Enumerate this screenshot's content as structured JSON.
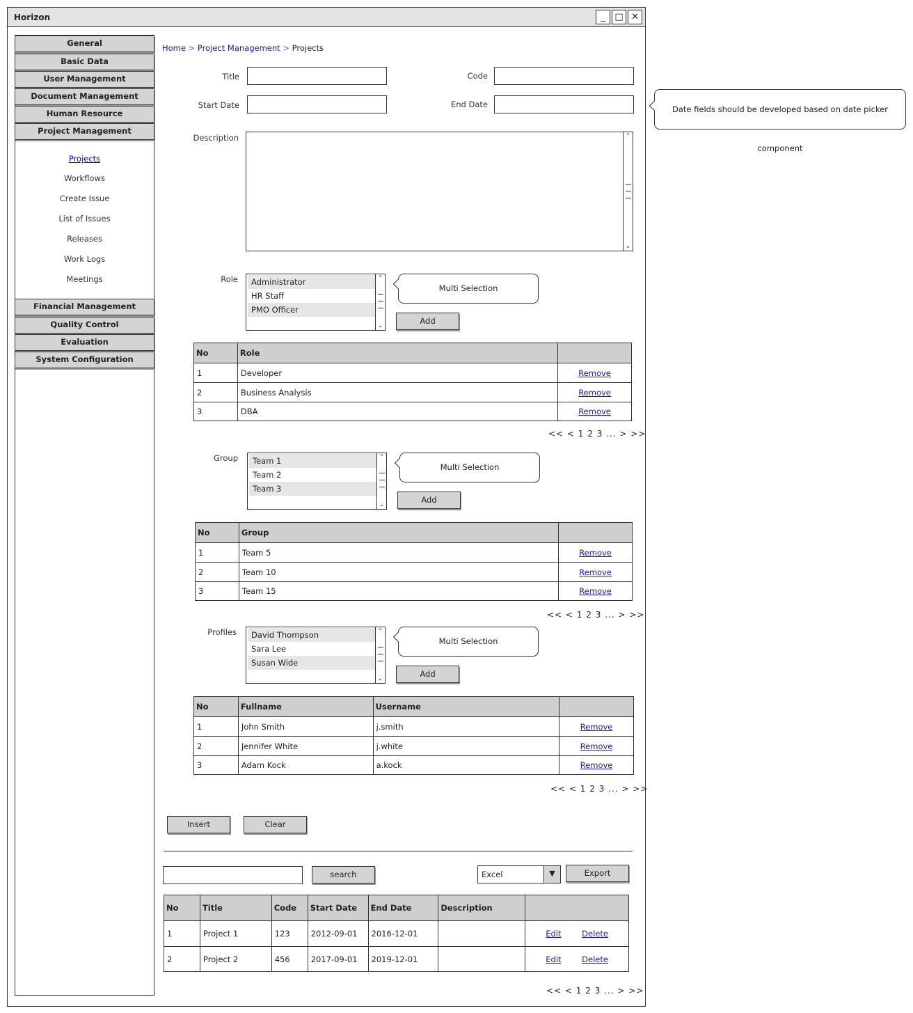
{
  "window": {
    "title": "Horizon",
    "controls": {
      "minimize": "_",
      "maximize": "□",
      "close": "✕"
    }
  },
  "sidebar": {
    "top_menu": [
      {
        "label": "General"
      },
      {
        "label": "Basic Data"
      },
      {
        "label": "User Management"
      },
      {
        "label": "Document Management"
      },
      {
        "label": "Human Resource"
      },
      {
        "label": "Project Management"
      }
    ],
    "sub_items": [
      {
        "label": "Projects"
      },
      {
        "label": "Workflows"
      },
      {
        "label": "Create Issue"
      },
      {
        "label": "List of Issues"
      },
      {
        "label": "Releases"
      },
      {
        "label": "Work Logs"
      },
      {
        "label": "Meetings"
      }
    ],
    "bottom_menu": [
      {
        "label": "Financial Management"
      },
      {
        "label": "Quality Control"
      },
      {
        "label": "Evaluation"
      },
      {
        "label": "System Configuration"
      }
    ]
  },
  "breadcrumb": {
    "home": "Home",
    "sep": ">",
    "section": "Project Management",
    "current": "Projects"
  },
  "form": {
    "title_label": "Title",
    "code_label": "Code",
    "start_date_label": "Start Date",
    "end_date_label": "End Date",
    "description_label": "Description",
    "date_note": "Date fields should be developed based on date picker component"
  },
  "role": {
    "label": "Role",
    "options": [
      "Administrator",
      "HR Staff",
      "PMO Officer"
    ],
    "callout": "Multi Selection",
    "add_label": "Add",
    "table": {
      "headers": [
        "No",
        "Role",
        ""
      ],
      "rows": [
        {
          "no": "1",
          "name": "Developer",
          "action": "Remove"
        },
        {
          "no": "2",
          "name": "Business Analysis",
          "action": "Remove"
        },
        {
          "no": "3",
          "name": "DBA",
          "action": "Remove"
        }
      ]
    },
    "pager": "<< < 1 2 3 ... > >>"
  },
  "group": {
    "label": "Group",
    "options": [
      "Team 1",
      "Team 2",
      "Team 3"
    ],
    "callout": "Multi Selection",
    "add_label": "Add",
    "table": {
      "headers": [
        "No",
        "Group",
        ""
      ],
      "rows": [
        {
          "no": "1",
          "name": "Team 5",
          "action": "Remove"
        },
        {
          "no": "2",
          "name": "Team 10",
          "action": "Remove"
        },
        {
          "no": "3",
          "name": "Team 15",
          "action": "Remove"
        }
      ]
    },
    "pager": "<< < 1 2 3 ... > >>"
  },
  "profiles": {
    "label": "Profiles",
    "options": [
      "David Thompson",
      "Sara Lee",
      "Susan Wide"
    ],
    "callout": "Multi Selection",
    "add_label": "Add",
    "table": {
      "headers": [
        "No",
        "Fullname",
        "Username",
        ""
      ],
      "rows": [
        {
          "no": "1",
          "fullname": "John Smith",
          "username": "j.smith",
          "action": "Remove"
        },
        {
          "no": "2",
          "fullname": "Jennifer White",
          "username": "j.white",
          "action": "Remove"
        },
        {
          "no": "3",
          "fullname": "Adam Kock",
          "username": "a.kock",
          "action": "Remove"
        }
      ]
    },
    "pager": "<< < 1 2 3 ... > >>"
  },
  "actions": {
    "insert": "Insert",
    "clear": "Clear"
  },
  "search": {
    "button": "search",
    "export_format": "Excel",
    "export_button": "Export"
  },
  "projects_table": {
    "headers": [
      "No",
      "Title",
      "Code",
      "Start Date",
      "End Date",
      "Description",
      ""
    ],
    "rows": [
      {
        "no": "1",
        "title": "Project 1",
        "code": "123",
        "start": "2012-09-01",
        "end": "2016-12-01",
        "description": "",
        "edit": "Edit",
        "delete": "Delete"
      },
      {
        "no": "2",
        "title": "Project 2",
        "code": "456",
        "start": "2017-09-01",
        "end": "2019-12-01",
        "description": "",
        "edit": "Edit",
        "delete": "Delete"
      }
    ],
    "pager": "<< < 1 2 3 ... > >>"
  }
}
